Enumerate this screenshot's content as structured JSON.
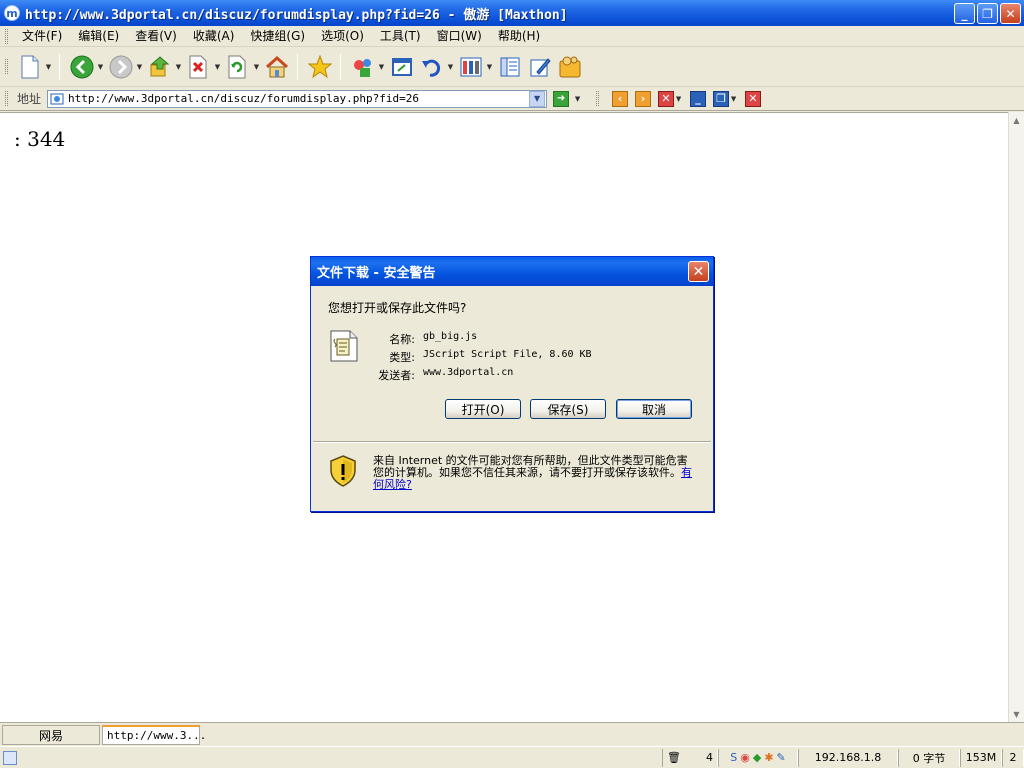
{
  "window": {
    "title": "http://www.3dportal.cn/discuz/forumdisplay.php?fid=26 - 傲游 [Maxthon]"
  },
  "menu": {
    "items": [
      "文件(F)",
      "编辑(E)",
      "查看(V)",
      "收藏(A)",
      "快捷组(G)",
      "选项(O)",
      "工具(T)",
      "窗口(W)",
      "帮助(H)"
    ]
  },
  "address": {
    "label": "地址",
    "url": "http://www.3dportal.cn/discuz/forumdisplay.php?fid=26"
  },
  "page": {
    "text": ": 344"
  },
  "dialog": {
    "title": "文件下载 - 安全警告",
    "question": "您想打开或保存此文件吗?",
    "name_label": "名称:",
    "name_value": "gb_big.js",
    "type_label": "类型:",
    "type_value": "JScript Script File, 8.60 KB",
    "sender_label": "发送者:",
    "sender_value": "www.3dportal.cn",
    "open_button": "打开(O)",
    "save_button": "保存(S)",
    "cancel_button": "取消",
    "warning_text": "来自 Internet 的文件可能对您有所帮助，但此文件类型可能危害您的计算机。如果您不信任其来源，请不要打开或保存该软件。",
    "risk_link": "有何风险?"
  },
  "tabs": [
    {
      "label": "网易"
    },
    {
      "label": "http://www.3..."
    }
  ],
  "status": {
    "count": "4",
    "ip": "192.168.1.8",
    "bytes": "0 字节",
    "memory": "153M",
    "last": "2"
  },
  "colors": {
    "title_blue": "#0a4fd6",
    "chrome_beige": "#ece9d8",
    "dialog_border": "#0831d9"
  }
}
